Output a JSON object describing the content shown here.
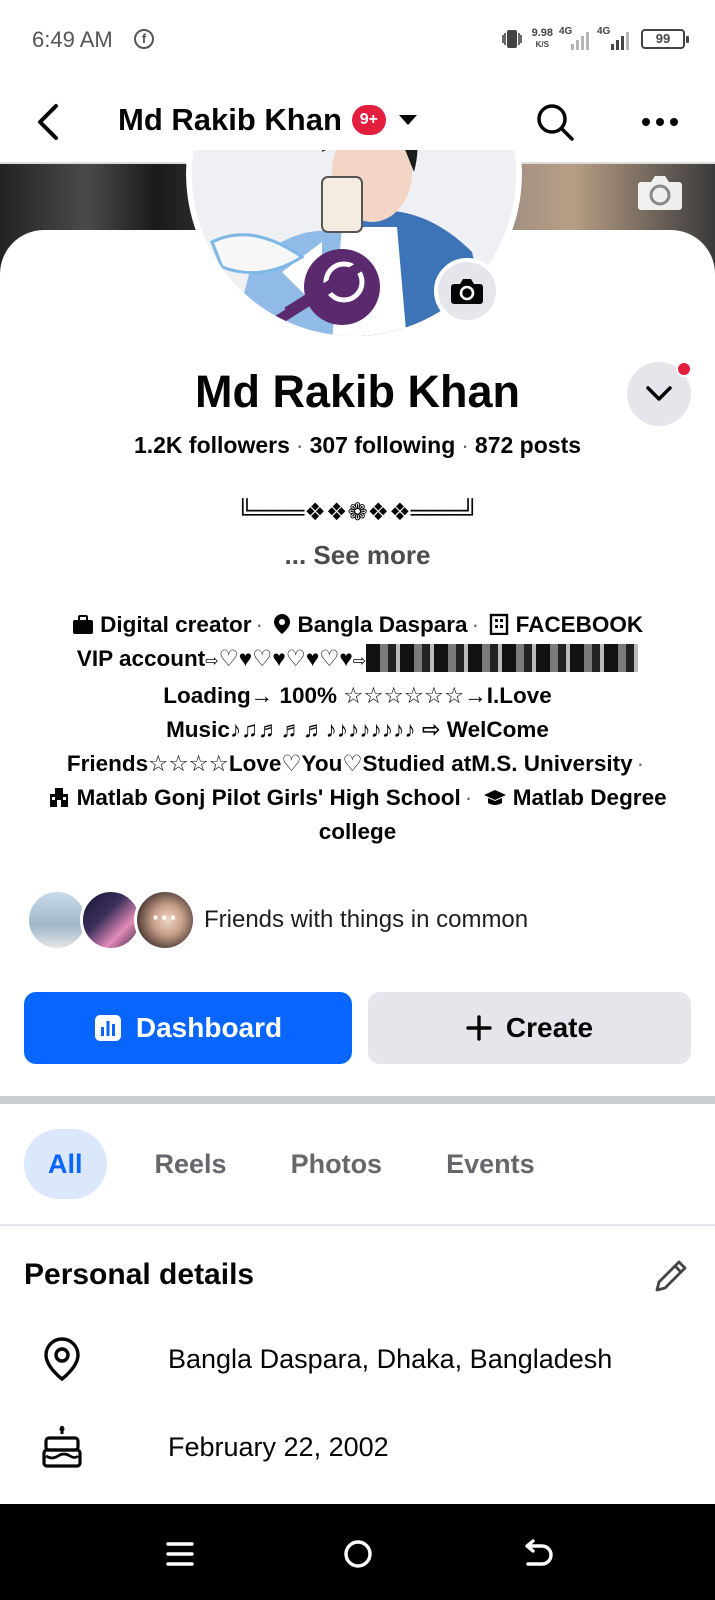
{
  "status_bar": {
    "time": "6:49 AM",
    "app_icon": "facebook-icon",
    "net_speed": "9.98",
    "net_unit": "K/S",
    "sim1": "4G",
    "sim2": "4G",
    "battery": "99"
  },
  "header": {
    "title": "Md Rakib Khan",
    "badge": "9+",
    "icons": [
      "back-arrow-icon",
      "caret-down-icon",
      "search-icon",
      "more-dots-icon"
    ]
  },
  "profile": {
    "name": "Md Rakib Khan",
    "stats": {
      "followers": "1.2K followers",
      "following": "307 following",
      "posts": "872 posts"
    },
    "bio_decoration": "╚═══❖❖❁❖❖═══╝",
    "see_more": "... See more"
  },
  "intro": {
    "category": "Digital creator",
    "location": "Bangla Daspara",
    "workplace": "FACEBOOK",
    "line2_text": "VIP account",
    "line2_arrow1": "⇨",
    "line2_hearts": "♡♥♡♥♡♥♡♥",
    "line2_arrow2": "⇨",
    "line3": "Loading→ 100% ☆☆☆☆☆☆→I.Love",
    "line4": "Music♪♫♬♬♬♪♪♪♪♪♪♪♪ ⇨ WelCome",
    "line5_text": "Friends☆☆☆☆Love♡You♡Studied atM.S. University",
    "school": "Matlab Gonj Pilot Girls' High School",
    "college_part1": "Matlab Degree",
    "college_part2": "college"
  },
  "friends": {
    "label": "Friends with things in common",
    "more": "···"
  },
  "actions": {
    "dashboard": "Dashboard",
    "create": "Create"
  },
  "colors": {
    "primary": "#0866ff",
    "badge_red": "#e41e3f",
    "secondary_button": "#e4e6eb",
    "active_tab_bg": "#dbe7fb"
  },
  "tabs": [
    {
      "label": "All",
      "active": true
    },
    {
      "label": "Reels",
      "active": false
    },
    {
      "label": "Photos",
      "active": false
    },
    {
      "label": "Events",
      "active": false
    }
  ],
  "personal_details": {
    "title": "Personal details",
    "location": "Bangla Daspara, Dhaka, Bangladesh",
    "birthday": "February 22, 2002"
  },
  "nav": {
    "icons": [
      "menu-icon",
      "home-circle-icon",
      "back-nav-icon"
    ]
  }
}
